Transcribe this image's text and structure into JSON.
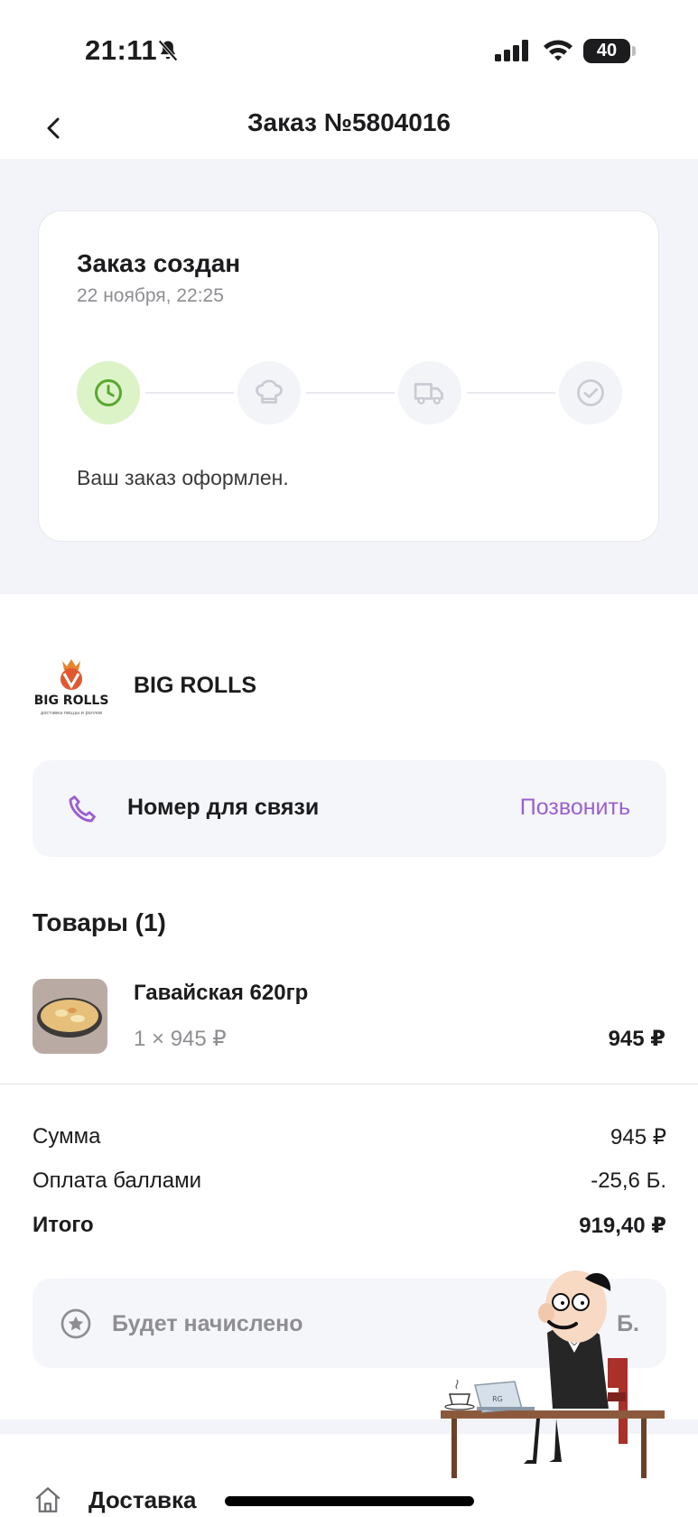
{
  "status_bar": {
    "time": "21:11",
    "battery": "40"
  },
  "header": {
    "title": "Заказ №5804016"
  },
  "order_status": {
    "title": "Заказ создан",
    "date": "22 ноября,  22:25",
    "steps": [
      {
        "icon": "clock-icon",
        "active": true
      },
      {
        "icon": "chef-hat-icon",
        "active": false
      },
      {
        "icon": "delivery-truck-icon",
        "active": false
      },
      {
        "icon": "check-circle-icon",
        "active": false
      }
    ],
    "message": "Ваш заказ оформлен."
  },
  "restaurant": {
    "name": "BIG ROLLS",
    "logo_text": "BIG ROLLS",
    "logo_subtext": "доставка пиццы и роллов"
  },
  "contact": {
    "label": "Номер для связи",
    "action": "Позвонить"
  },
  "items": {
    "heading": "Товары (1)",
    "list": [
      {
        "name": "Гавайская 620гр",
        "qty_price": "1 × 945 ₽",
        "total": "945 ₽"
      }
    ]
  },
  "summary": {
    "sum_label": "Сумма",
    "sum_value": "945 ₽",
    "points_label": "Оплата баллами",
    "points_value": "-25,6 Б.",
    "total_label": "Итого",
    "total_value": "919,40 ₽"
  },
  "bonus": {
    "label": "Будет начислено",
    "value": "Б."
  },
  "footer": {
    "delivery_label": "Доставка"
  },
  "overlay": {
    "laptop_text": "RG"
  },
  "colors": {
    "accent": "#9b5fd0",
    "active_step": "#dcf3c8",
    "active_icon": "#5aa72f",
    "background": "#f3f4f9"
  }
}
